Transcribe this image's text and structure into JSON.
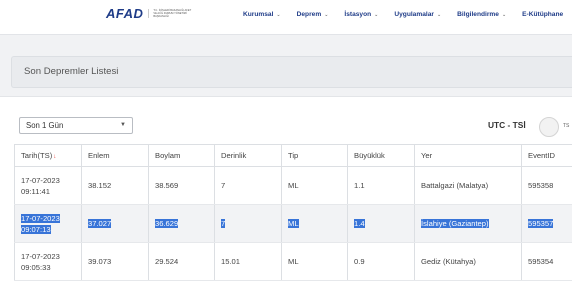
{
  "brand": {
    "logo": "AFAD",
    "sub": "T.C. İÇİŞLERİ BAKANLIĞI AFET VE ACİL DURUM YÖNETİMİ BAŞKANLIĞI"
  },
  "nav": [
    {
      "label": "Kurumsal"
    },
    {
      "label": "Deprem"
    },
    {
      "label": "İstasyon"
    },
    {
      "label": "Uygulamalar"
    },
    {
      "label": "Bilgilendirme"
    },
    {
      "label": "E-Kütüphane"
    }
  ],
  "page_title": "Son Depremler Listesi",
  "filter": {
    "selected": "Son 1 Gün"
  },
  "time_toggle": {
    "label": "UTC - TSİ",
    "state_label": "TS"
  },
  "table": {
    "headers": [
      "Tarih(TS)",
      "Enlem",
      "Boylam",
      "Derinlik",
      "Tip",
      "Büyüklük",
      "Yer",
      "EventID"
    ],
    "rows": [
      {
        "date": "17-07-2023",
        "time": "09:11:41",
        "lat": "38.152",
        "lon": "38.569",
        "depth": "7",
        "type": "ML",
        "mag": "1.1",
        "place": "Battalgazi (Malatya)",
        "id": "595358"
      },
      {
        "date": "17-07-2023",
        "time": "09:07:13",
        "lat": "37.027",
        "lon": "36.629",
        "depth": "7",
        "type": "ML",
        "mag": "1.4",
        "place": "İslahiye (Gaziantep)",
        "id": "595357"
      },
      {
        "date": "17-07-2023",
        "time": "09:05:33",
        "lat": "39.073",
        "lon": "29.524",
        "depth": "15.01",
        "type": "ML",
        "mag": "0.9",
        "place": "Gediz (Kütahya)",
        "id": "595354"
      }
    ]
  }
}
